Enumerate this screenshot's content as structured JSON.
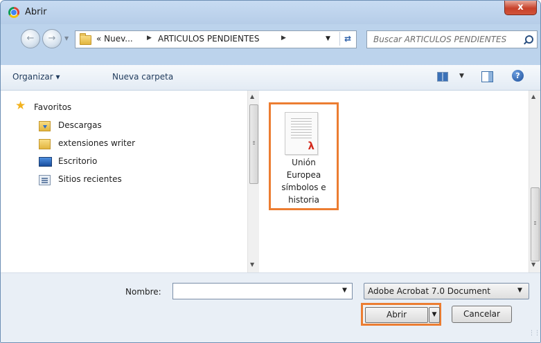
{
  "window": {
    "title": "Abrir",
    "close_label": "x"
  },
  "address": {
    "back_icon": "back-arrow-icon",
    "forward_icon": "forward-arrow-icon",
    "breadcrumb_prefix": "« Nuev...",
    "breadcrumb_current": "ARTICULOS PENDIENTES",
    "refresh_label": "⁺⁄₊",
    "search_placeholder": "Buscar ARTICULOS PENDIENTES"
  },
  "toolbar": {
    "organize_label": "Organizar ▾",
    "new_folder_label": "Nueva carpeta",
    "help_label": "?"
  },
  "nav_pane": {
    "items": [
      {
        "label": "Favoritos",
        "icon": "star-icon"
      },
      {
        "label": "Descargas",
        "icon": "downloads-folder-icon"
      },
      {
        "label": "extensiones writer",
        "icon": "folder-icon"
      },
      {
        "label": "Escritorio",
        "icon": "desktop-icon"
      },
      {
        "label": "Sitios recientes",
        "icon": "recent-places-icon"
      }
    ]
  },
  "files": [
    {
      "name_lines": [
        "Unión",
        "Europea",
        "símbolos e",
        "historia"
      ],
      "icon": "pdf-file-icon"
    }
  ],
  "bottom": {
    "name_label": "Nombre:",
    "name_value": "",
    "filetype_value": "Adobe Acrobat 7.0 Document",
    "open_label": "Abrir",
    "cancel_label": "Cancelar"
  },
  "colors": {
    "highlight": "#ec7d31",
    "window_frame": "#bcd3ec",
    "close_button": "#c7422a"
  }
}
